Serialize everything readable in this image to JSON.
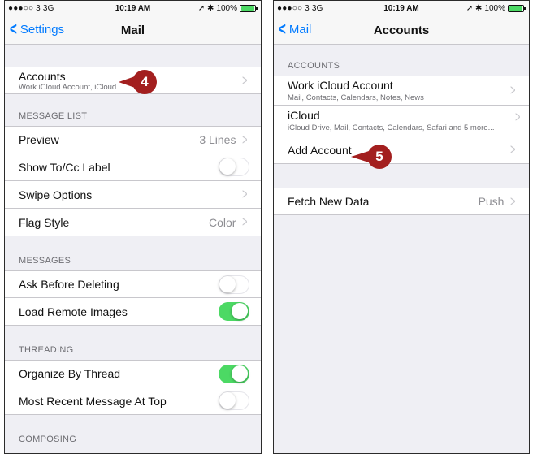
{
  "status_bar": {
    "signal": "●●●○○ 3  3G",
    "time": "10:19 AM",
    "icons": "➚ ✱",
    "battery": "100%",
    "battery_color": "#4cd964"
  },
  "left": {
    "back_label": "Settings",
    "title": "Mail",
    "accounts": {
      "label": "Accounts",
      "sub": "Work iCloud Account, iCloud"
    },
    "callout": "4",
    "message_list_header": "MESSAGE LIST",
    "message_list": [
      {
        "label": "Preview",
        "value": "3 Lines",
        "type": "chevron"
      },
      {
        "label": "Show To/Cc Label",
        "type": "toggle",
        "on": false
      },
      {
        "label": "Swipe Options",
        "value": "",
        "type": "chevron"
      },
      {
        "label": "Flag Style",
        "value": "Color",
        "type": "chevron"
      }
    ],
    "messages_header": "MESSAGES",
    "messages": [
      {
        "label": "Ask Before Deleting",
        "type": "toggle",
        "on": false
      },
      {
        "label": "Load Remote Images",
        "type": "toggle",
        "on": true
      }
    ],
    "threading_header": "THREADING",
    "threading": [
      {
        "label": "Organize By Thread",
        "type": "toggle",
        "on": true
      },
      {
        "label": "Most Recent Message At Top",
        "type": "toggle",
        "on": false
      }
    ],
    "composing_header": "COMPOSING"
  },
  "right": {
    "back_label": "Mail",
    "title": "Accounts",
    "accounts_header": "ACCOUNTS",
    "accounts": [
      {
        "label": "Work iCloud Account",
        "sub": "Mail, Contacts, Calendars, Notes, News"
      },
      {
        "label": "iCloud",
        "sub": "iCloud Drive, Mail, Contacts, Calendars, Safari and 5 more..."
      }
    ],
    "add_account": "Add Account",
    "callout": "5",
    "fetch": {
      "label": "Fetch New Data",
      "value": "Push"
    }
  },
  "colors": {
    "accent": "#007aff",
    "toggle_on": "#4cd964",
    "callout": "#a31f1f",
    "background": "#efeff4"
  }
}
